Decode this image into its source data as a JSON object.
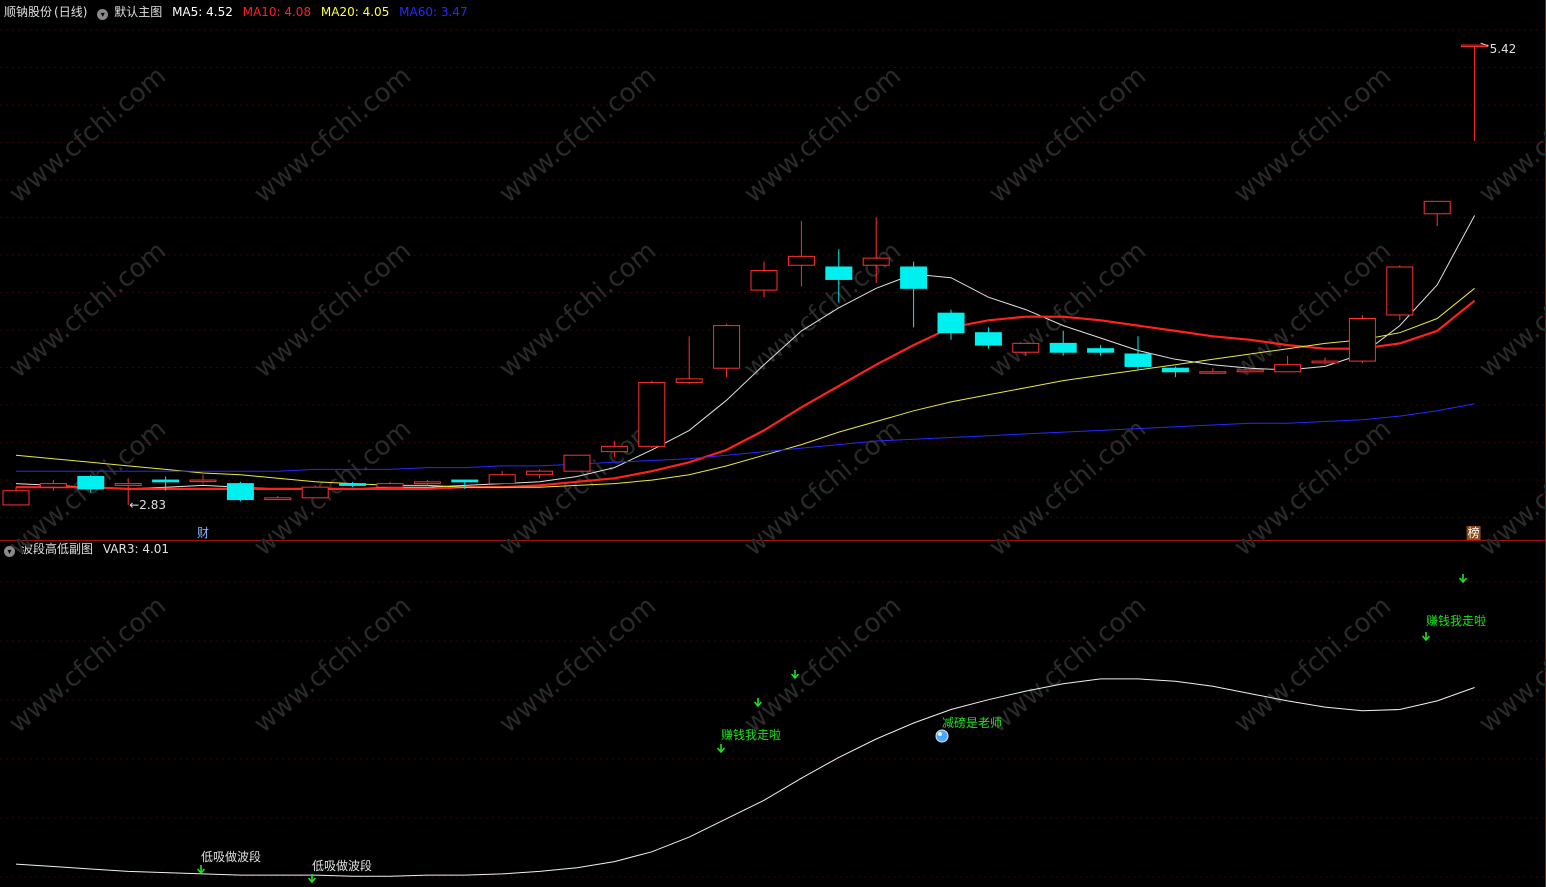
{
  "main_panel": {
    "stock_name": "顺钠股份",
    "period": "(日线)",
    "template": "默认主图",
    "indicators": [
      {
        "label": "MA5: 4.52",
        "color": "#ffffff"
      },
      {
        "label": "MA10: 4.08",
        "color": "#ff2020"
      },
      {
        "label": "MA20: 4.05",
        "color": "#ffff40"
      },
      {
        "label": "MA60: 3.47",
        "color": "#2828ff"
      }
    ],
    "high_label": "5.42",
    "low_label": "←2.83",
    "marker_cai": "财",
    "marker_bang": "榜"
  },
  "sub_panel": {
    "title": "波段高低副图",
    "var_label": "VAR3: 4.01",
    "signals": [
      {
        "text": "低吸做波段",
        "color": "#e0e0e0"
      },
      {
        "text": "低吸做波段",
        "color": "#e0e0e0"
      },
      {
        "text": "赚钱我走啦",
        "color": "#20e020"
      },
      {
        "text": "减磅是老师",
        "color": "#20e020"
      },
      {
        "text": "赚钱我走啦",
        "color": "#20e020"
      }
    ]
  },
  "watermark": "www.cfchi.com",
  "chart_data": {
    "type": "candlestick",
    "title": "",
    "xlabel": "",
    "ylabel": "",
    "ylim": [
      2.7,
      5.55
    ],
    "candles": [
      {
        "o": 2.83,
        "h": 2.93,
        "l": 2.83,
        "c": 2.91
      },
      {
        "o": 2.93,
        "h": 2.97,
        "l": 2.91,
        "c": 2.95
      },
      {
        "o": 2.99,
        "h": 3.0,
        "l": 2.9,
        "c": 2.92
      },
      {
        "o": 2.94,
        "h": 2.98,
        "l": 2.83,
        "c": 2.95
      },
      {
        "o": 2.97,
        "h": 2.99,
        "l": 2.91,
        "c": 2.96
      },
      {
        "o": 2.97,
        "h": 3.0,
        "l": 2.95,
        "c": 2.97
      },
      {
        "o": 2.95,
        "h": 2.96,
        "l": 2.85,
        "c": 2.86
      },
      {
        "o": 2.86,
        "h": 2.88,
        "l": 2.86,
        "c": 2.87
      },
      {
        "o": 2.87,
        "h": 2.94,
        "l": 2.87,
        "c": 2.93
      },
      {
        "o": 2.95,
        "h": 2.96,
        "l": 2.93,
        "c": 2.94
      },
      {
        "o": 2.93,
        "h": 2.96,
        "l": 2.93,
        "c": 2.95
      },
      {
        "o": 2.95,
        "h": 2.97,
        "l": 2.94,
        "c": 2.96
      },
      {
        "o": 2.97,
        "h": 2.97,
        "l": 2.92,
        "c": 2.96
      },
      {
        "o": 2.95,
        "h": 3.02,
        "l": 2.95,
        "c": 3.0
      },
      {
        "o": 3.0,
        "h": 3.03,
        "l": 2.98,
        "c": 3.02
      },
      {
        "o": 3.02,
        "h": 3.11,
        "l": 3.02,
        "c": 3.11
      },
      {
        "o": 3.13,
        "h": 3.19,
        "l": 3.1,
        "c": 3.16
      },
      {
        "o": 3.16,
        "h": 3.53,
        "l": 3.15,
        "c": 3.52
      },
      {
        "o": 3.52,
        "h": 3.78,
        "l": 3.51,
        "c": 3.54
      },
      {
        "o": 3.6,
        "h": 3.85,
        "l": 3.55,
        "c": 3.84
      },
      {
        "o": 4.04,
        "h": 4.2,
        "l": 4.0,
        "c": 4.15
      },
      {
        "o": 4.18,
        "h": 4.43,
        "l": 4.06,
        "c": 4.23
      },
      {
        "o": 4.17,
        "h": 4.27,
        "l": 3.97,
        "c": 4.1
      },
      {
        "o": 4.18,
        "h": 4.45,
        "l": 4.08,
        "c": 4.22
      },
      {
        "o": 4.17,
        "h": 4.2,
        "l": 3.83,
        "c": 4.05
      },
      {
        "o": 3.91,
        "h": 3.93,
        "l": 3.76,
        "c": 3.8
      },
      {
        "o": 3.8,
        "h": 3.83,
        "l": 3.71,
        "c": 3.73
      },
      {
        "o": 3.69,
        "h": 3.74,
        "l": 3.67,
        "c": 3.74
      },
      {
        "o": 3.74,
        "h": 3.81,
        "l": 3.67,
        "c": 3.69
      },
      {
        "o": 3.71,
        "h": 3.73,
        "l": 3.67,
        "c": 3.69
      },
      {
        "o": 3.68,
        "h": 3.78,
        "l": 3.59,
        "c": 3.61
      },
      {
        "o": 3.6,
        "h": 3.61,
        "l": 3.55,
        "c": 3.58
      },
      {
        "o": 3.58,
        "h": 3.6,
        "l": 3.57,
        "c": 3.58
      },
      {
        "o": 3.58,
        "h": 3.6,
        "l": 3.58,
        "c": 3.59
      },
      {
        "o": 3.58,
        "h": 3.67,
        "l": 3.58,
        "c": 3.62
      },
      {
        "o": 3.63,
        "h": 3.66,
        "l": 3.62,
        "c": 3.64
      },
      {
        "o": 3.64,
        "h": 3.9,
        "l": 3.63,
        "c": 3.88
      },
      {
        "o": 3.9,
        "h": 4.18,
        "l": 3.87,
        "c": 4.17
      },
      {
        "o": 4.47,
        "h": 4.54,
        "l": 4.4,
        "c": 4.54
      },
      {
        "o": 5.42,
        "h": 5.42,
        "l": 4.88,
        "c": 5.42
      }
    ],
    "series": [
      {
        "name": "MA5",
        "color": "#e0e0e0",
        "values": [
          2.95,
          2.94,
          2.93,
          2.92,
          2.93,
          2.94,
          2.93,
          2.92,
          2.92,
          2.92,
          2.93,
          2.93,
          2.94,
          2.95,
          2.96,
          2.99,
          3.04,
          3.14,
          3.25,
          3.42,
          3.62,
          3.81,
          3.94,
          4.05,
          4.13,
          4.11,
          4.0,
          3.93,
          3.84,
          3.77,
          3.7,
          3.65,
          3.62,
          3.6,
          3.59,
          3.61,
          3.68,
          3.84,
          4.07,
          4.46
        ]
      },
      {
        "name": "MA10",
        "color": "#ff2020",
        "values": [
          2.93,
          2.93,
          2.93,
          2.92,
          2.92,
          2.92,
          2.92,
          2.92,
          2.92,
          2.92,
          2.92,
          2.92,
          2.93,
          2.93,
          2.94,
          2.96,
          2.98,
          3.02,
          3.07,
          3.14,
          3.25,
          3.38,
          3.5,
          3.62,
          3.73,
          3.83,
          3.87,
          3.89,
          3.89,
          3.87,
          3.84,
          3.81,
          3.78,
          3.76,
          3.73,
          3.71,
          3.71,
          3.74,
          3.81,
          3.98
        ]
      },
      {
        "name": "MA20",
        "color": "#e8e840",
        "values": [
          3.11,
          3.09,
          3.07,
          3.05,
          3.03,
          3.01,
          3.0,
          2.98,
          2.96,
          2.95,
          2.94,
          2.94,
          2.93,
          2.93,
          2.93,
          2.94,
          2.95,
          2.97,
          3.0,
          3.05,
          3.11,
          3.17,
          3.24,
          3.3,
          3.36,
          3.41,
          3.45,
          3.49,
          3.53,
          3.56,
          3.59,
          3.62,
          3.65,
          3.68,
          3.71,
          3.74,
          3.76,
          3.8,
          3.88,
          4.05
        ]
      },
      {
        "name": "MA60",
        "color": "#2828ff",
        "values": [
          3.02,
          3.02,
          3.02,
          3.02,
          3.02,
          3.02,
          3.02,
          3.02,
          3.03,
          3.03,
          3.03,
          3.04,
          3.04,
          3.05,
          3.05,
          3.06,
          3.07,
          3.08,
          3.09,
          3.11,
          3.13,
          3.15,
          3.17,
          3.19,
          3.2,
          3.21,
          3.22,
          3.23,
          3.24,
          3.25,
          3.26,
          3.27,
          3.28,
          3.29,
          3.29,
          3.3,
          3.31,
          3.33,
          3.36,
          3.4
        ]
      }
    ],
    "sub_series": {
      "name": "VAR3",
      "ylim": [
        2.55,
        5.2
      ],
      "values": [
        2.68,
        2.66,
        2.64,
        2.62,
        2.61,
        2.6,
        2.59,
        2.59,
        2.59,
        2.58,
        2.58,
        2.59,
        2.59,
        2.6,
        2.62,
        2.65,
        2.7,
        2.78,
        2.9,
        3.05,
        3.2,
        3.38,
        3.55,
        3.7,
        3.83,
        3.94,
        4.02,
        4.09,
        4.15,
        4.19,
        4.19,
        4.17,
        4.13,
        4.07,
        4.01,
        3.96,
        3.93,
        3.94,
        4.01,
        4.12
      ]
    }
  }
}
